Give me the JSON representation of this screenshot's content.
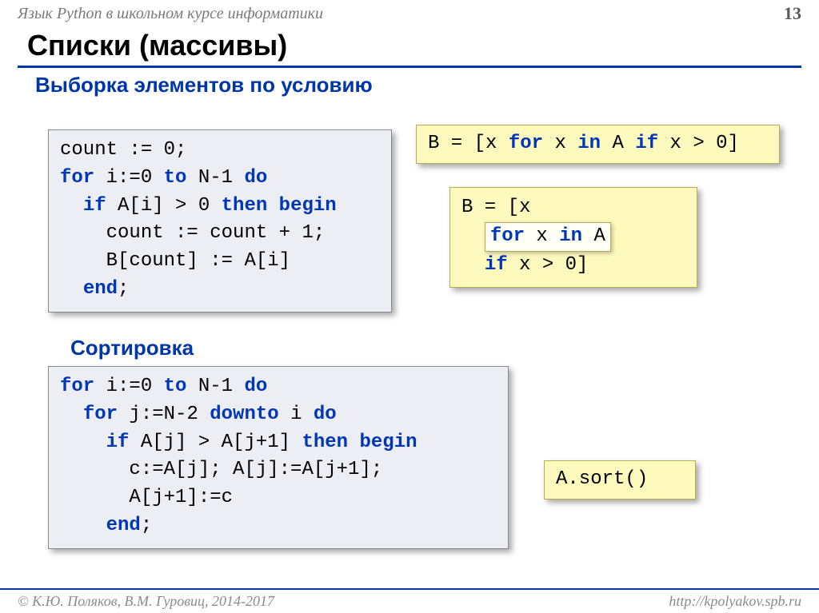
{
  "header": {
    "course": "Язык Python в школьном курсе информатики",
    "page": "13"
  },
  "title": "Списки (массивы)",
  "section1": "Выборка элементов по условию",
  "section2": "Сортировка",
  "pascal_filter": {
    "l1a": "count := 0;",
    "l2a": "for",
    "l2b": " i:=0 ",
    "l2c": "to",
    "l2d": " N-1 ",
    "l2e": "do",
    "l3a": "  ",
    "l3b": "if",
    "l3c": " A[i] > 0 ",
    "l3d": "then begin",
    "l4": "    count := count + 1;",
    "l5": "    B[count] := A[i]",
    "l6a": "  ",
    "l6b": "end",
    "l6c": ";"
  },
  "python_filter_one": {
    "a": "B = [x ",
    "b": "for",
    "c": " x ",
    "d": "in",
    "e": " A ",
    "f": "if",
    "g": " x > 0]"
  },
  "python_filter_split": {
    "l1": "B = [x",
    "l2a": "for",
    "l2b": " x ",
    "l2c": "in",
    "l2d": " A",
    "l3a": "  ",
    "l3b": "if",
    "l3c": " x > 0]"
  },
  "pascal_sort": {
    "l1a": "for",
    "l1b": " i:=0 ",
    "l1c": "to",
    "l1d": " N-1 ",
    "l1e": "do",
    "l2a": "  ",
    "l2b": "for",
    "l2c": " j:=N-2 ",
    "l2d": "downto",
    "l2e": " i ",
    "l2f": "do",
    "l3a": "    ",
    "l3b": "if",
    "l3c": " A[j] > A[j+1] ",
    "l3d": "then begin",
    "l4": "      c:=A[j]; A[j]:=A[j+1];",
    "l5": "      A[j+1]:=c",
    "l6a": "    ",
    "l6b": "end",
    "l6c": ";"
  },
  "python_sort": "A.sort()",
  "footer": {
    "left": "© К.Ю. Поляков, В.М. Гуровиц, 2014-2017",
    "right": "http://kpolyakov.spb.ru"
  }
}
